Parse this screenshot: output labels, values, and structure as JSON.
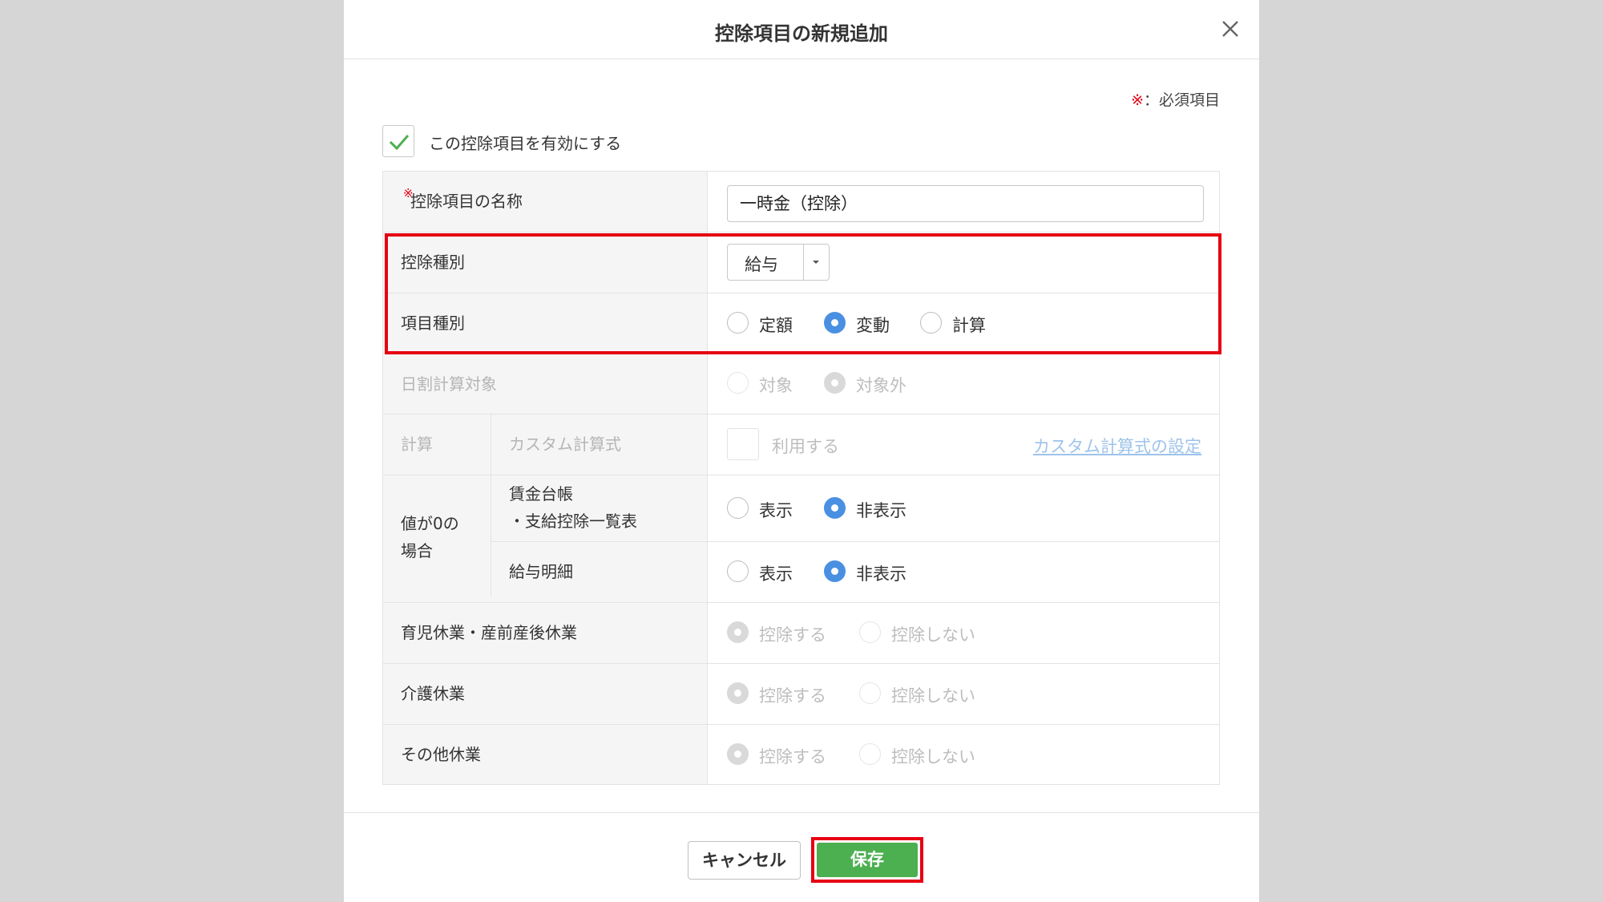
{
  "dialog": {
    "title": "控除項目の新規追加",
    "required_mark": "※",
    "required_label": "：必須項目"
  },
  "enable": {
    "checked": true,
    "label": "この控除項目を有効にする"
  },
  "fields": {
    "name": {
      "required_mark": "※",
      "label": "控除項目の名称",
      "value": "一時金（控除）"
    },
    "deduction_type": {
      "label": "控除種別",
      "selected": "給与"
    },
    "item_type": {
      "label": "項目種別",
      "options": [
        "定額",
        "変動",
        "計算"
      ],
      "selected": "変動"
    },
    "daily_calc": {
      "label": "日割計算対象",
      "options": [
        "対象",
        "対象外"
      ],
      "selected": "対象外"
    },
    "calculation": {
      "label": "計算",
      "sub_label": "カスタム計算式",
      "checkbox_label": "利用する",
      "link": "カスタム計算式の設定"
    },
    "zero_value": {
      "label_line1": "値が0の",
      "label_line2": "場合",
      "ledger": {
        "label_line1": "賃金台帳",
        "label_line2": "・支給控除一覧表",
        "options": [
          "表示",
          "非表示"
        ],
        "selected": "非表示"
      },
      "payslip": {
        "label": "給与明細",
        "options": [
          "表示",
          "非表示"
        ],
        "selected": "非表示"
      }
    },
    "childcare_leave": {
      "label": "育児休業・産前産後休業",
      "options": [
        "控除する",
        "控除しない"
      ],
      "selected": "控除する"
    },
    "nursing_leave": {
      "label": "介護休業",
      "options": [
        "控除する",
        "控除しない"
      ],
      "selected": "控除する"
    },
    "other_leave": {
      "label": "その他休業",
      "options": [
        "控除する",
        "控除しない"
      ],
      "selected": "控除する"
    }
  },
  "footer": {
    "cancel_label": "キャンセル",
    "save_label": "保存"
  },
  "colors": {
    "accent_green": "#4caf50",
    "radio_blue": "#4a90e2",
    "required_red": "#e60012",
    "highlight_red": "#e60012"
  }
}
